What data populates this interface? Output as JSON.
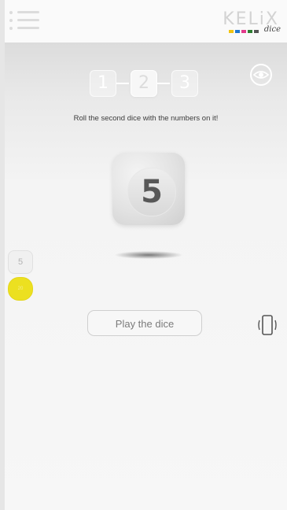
{
  "app": {
    "brand": "KELiX",
    "brand_tagline": "dice"
  },
  "steps": [
    "1",
    "2",
    "3"
  ],
  "active_step": 2,
  "instruction": "Roll the second dice with the numbers on it!",
  "dice": {
    "value": "5"
  },
  "results": {
    "first": "5",
    "second": "20"
  },
  "play_button": {
    "label": "Play the dice"
  },
  "colors": {
    "accent_yellow": "#ece020",
    "logo_squares": [
      "#f1c40f",
      "#1f77d0",
      "#e23a8b",
      "#2e7d32",
      "#555555"
    ]
  },
  "icons": {
    "menu": "menu-icon",
    "vision": "eye-icon",
    "shake": "phone-shake-icon"
  }
}
